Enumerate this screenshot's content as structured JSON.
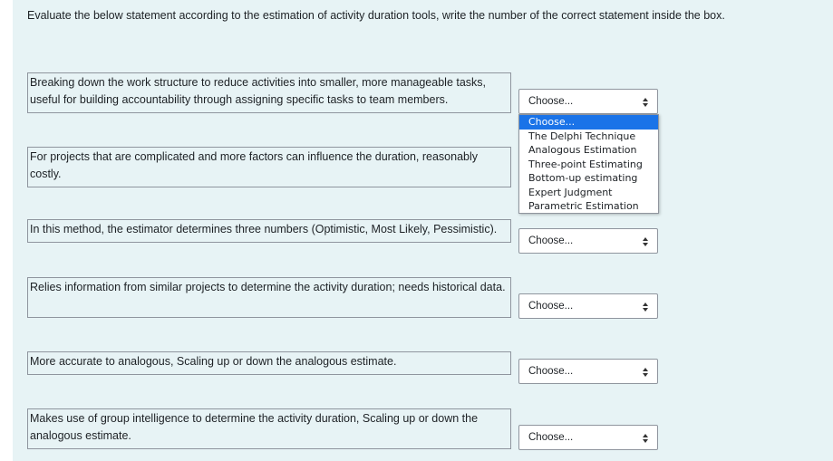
{
  "instruction": "Evaluate the below statement according to the estimation of activity duration tools, write the number of the correct statement inside the box.",
  "statements": [
    "Breaking down the work structure to reduce activities into smaller, more manageable tasks, useful for building accountability through assigning specific tasks to team members.",
    "For projects that are complicated and more factors can influence the duration, reasonably costly.",
    "In this method, the estimator determines three numbers (Optimistic, Most Likely, Pessimistic).",
    "Relies information from similar projects to determine the activity duration; needs historical data.",
    "More accurate to analogous, Scaling up or down the analogous estimate.",
    "Makes use of group intelligence to determine the activity duration, Scaling up or down the analogous estimate."
  ],
  "selects": [
    "Choose...",
    "Choose...",
    "Choose...",
    "Choose...",
    "Choose..."
  ],
  "dropdown": {
    "options": [
      "Choose...",
      "The Delphi Technique",
      "Analogous Estimation",
      "Three-point Estimating",
      "Bottom-up estimating",
      "Expert Judgment",
      "Parametric Estimation"
    ],
    "selected": "Choose..."
  },
  "colors": {
    "panel": "#e7f3f5",
    "highlight": "#1a73e8",
    "border": "#8f959e"
  }
}
